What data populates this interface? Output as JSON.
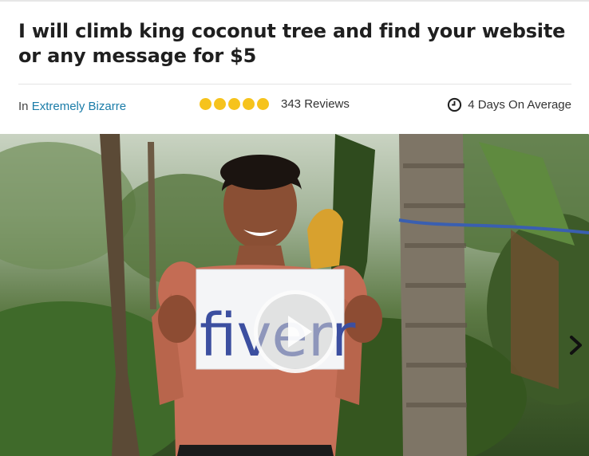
{
  "gig": {
    "title": "I will climb king coconut tree and find your website or any message for $5"
  },
  "meta": {
    "category_prefix": "In",
    "category_name": "Extremely Bizarre",
    "rating_stars": 5,
    "reviews_label": "343 Reviews",
    "delivery_label": "4 Days On Average"
  },
  "media": {
    "sign_text": "fiverr"
  },
  "icons": {
    "star": "star-icon",
    "clock": "clock-icon",
    "play": "play-icon",
    "next": "chevron-right-icon"
  },
  "colors": {
    "link": "#1a7ca8",
    "star": "#f6c31c"
  }
}
